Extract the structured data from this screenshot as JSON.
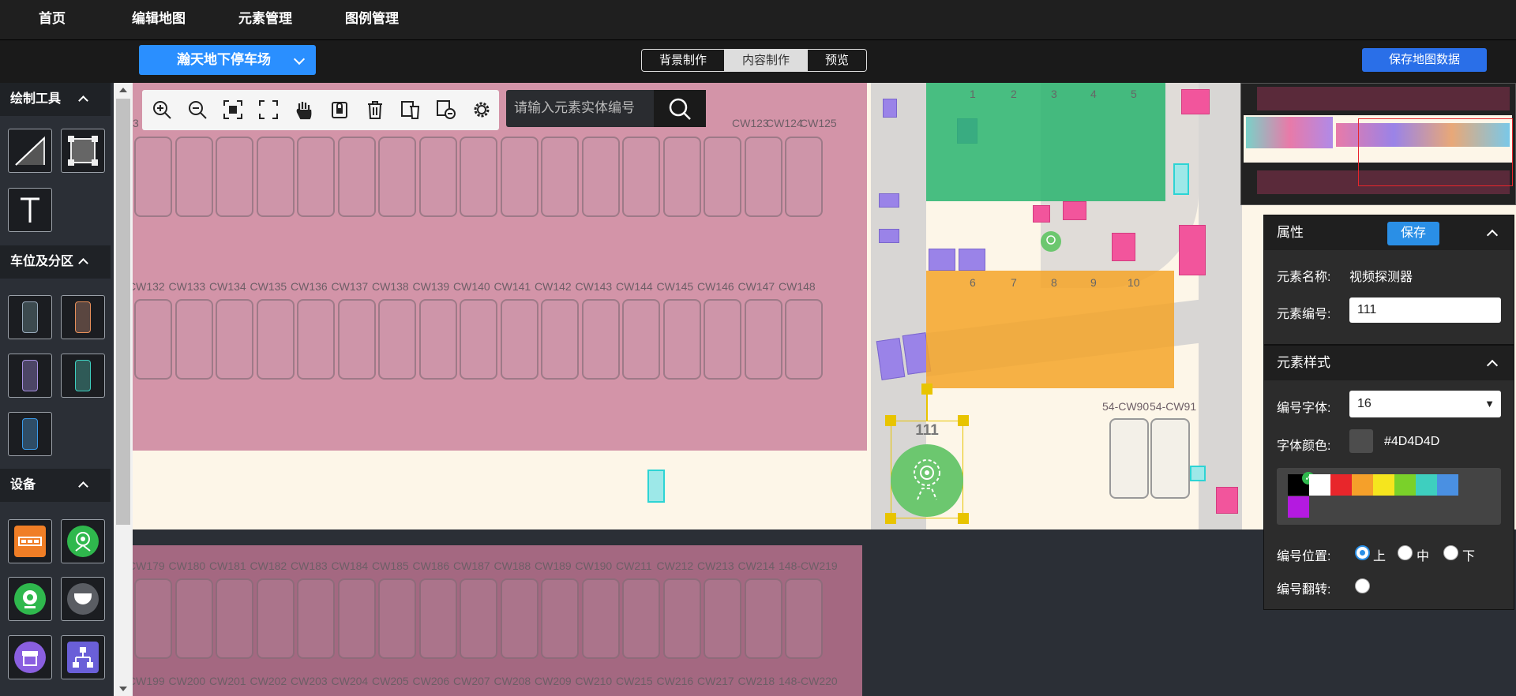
{
  "nav": {
    "items": [
      "首页",
      "编辑地图",
      "元素管理",
      "图例管理"
    ]
  },
  "subbar": {
    "lot_name": "瀚天地下停车场",
    "tabs": [
      "背景制作",
      "内容制作",
      "预览"
    ],
    "active_tab": "内容制作",
    "save_map_label": "保存地图数据"
  },
  "left": {
    "draw_tools_title": "绘制工具",
    "parking_title": "车位及分区",
    "devices_title": "设备"
  },
  "map": {
    "search_placeholder": "请输入元素实体编号",
    "selected_label": "111",
    "top_labels": [
      "3",
      "CW123",
      "CW124",
      "CW125"
    ],
    "row2_labels": [
      "CW132",
      "CW133",
      "CW134",
      "CW135",
      "CW136",
      "CW137",
      "CW138",
      "CW139",
      "CW140",
      "CW141",
      "CW142",
      "CW143",
      "CW144",
      "CW145",
      "CW146",
      "CW147",
      "CW148"
    ],
    "row3_labels": [
      "CW179",
      "CW180",
      "CW181",
      "CW182",
      "CW183",
      "CW184",
      "CW185",
      "CW186",
      "CW187",
      "CW188",
      "CW189",
      "CW190",
      "CW211",
      "CW212",
      "CW213",
      "CW214",
      "148-CW219"
    ],
    "row4_labels": [
      "CW199",
      "CW200",
      "CW201",
      "CW202",
      "CW203",
      "CW204",
      "CW205",
      "CW206",
      "CW207",
      "CW208",
      "CW209",
      "CW210",
      "CW215",
      "CW216",
      "CW217",
      "CW218",
      "148-CW220"
    ],
    "green_numbers": [
      "1",
      "2",
      "3",
      "4",
      "5"
    ],
    "orange_numbers": [
      "6",
      "7",
      "8",
      "9",
      "10"
    ],
    "right_labels": [
      "54-CW90",
      "54-CW91"
    ]
  },
  "properties": {
    "title": "属性",
    "save_label": "保存",
    "name_label": "元素名称:",
    "name_value": "视频探测器",
    "code_label": "元素编号:",
    "code_value": "111"
  },
  "style": {
    "title": "元素样式",
    "font_label": "编号字体:",
    "font_value": "16",
    "color_label": "字体颜色:",
    "color_value": "#4D4D4D",
    "palette": [
      "#000000",
      "#ffffff",
      "#e8262b",
      "#f5a02a",
      "#f5e51e",
      "#7ad12a",
      "#3ecfbf",
      "#4a90e2",
      "#b41ae0"
    ],
    "selected_palette_index": 0,
    "position_label": "编号位置:",
    "position_options": [
      "上",
      "中",
      "下"
    ],
    "position_selected": "上",
    "flip_label": "编号翻转:"
  }
}
